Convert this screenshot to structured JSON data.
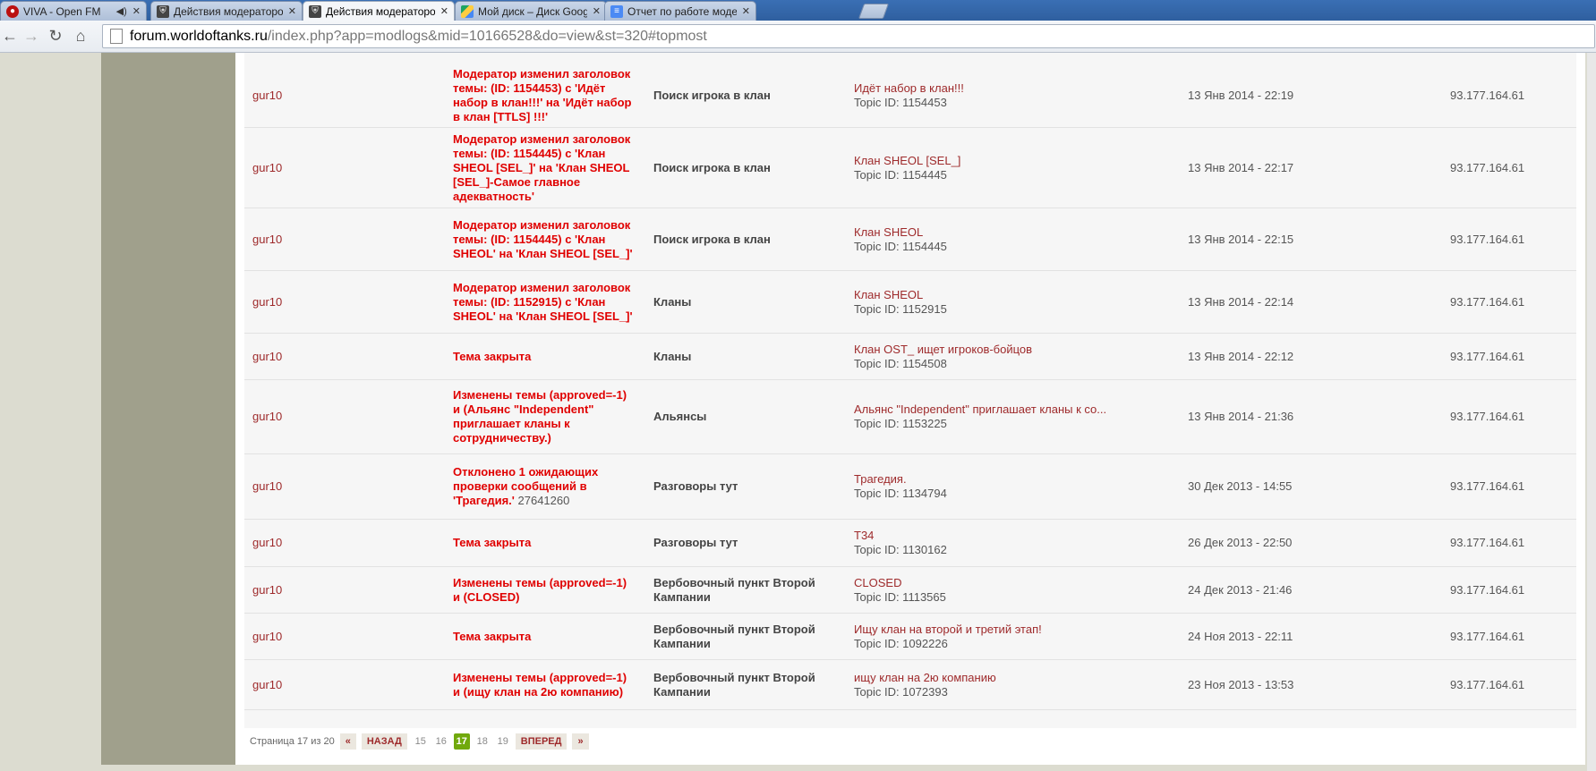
{
  "browser": {
    "tabs": [
      {
        "title": "VIVA - Open FM",
        "icon": "radio-icon",
        "extra": "speaker-icon"
      },
      {
        "title": "Действия модераторов - ",
        "icon": "wot-icon"
      },
      {
        "title": "Действия модераторов - ",
        "icon": "wot-icon",
        "active": true
      },
      {
        "title": "Мой диск – Диск Google",
        "icon": "google-drive-icon"
      },
      {
        "title": "Отчет по работе модерат",
        "icon": "google-docs-icon"
      }
    ],
    "url_host": "forum.worldoftanks.ru",
    "url_path": "/index.php?app=modlogs&mid=10166528&do=view&st=320#topmost"
  },
  "rows": [
    {
      "user": "gur10",
      "action": "Модератор изменил заголовок темы: (ID: 1154453) с 'Идёт набор в клан!!!' на 'Идёт набор в клан [TTLS] !!!'",
      "action_id": "",
      "forum": "Поиск игрока в клан",
      "topic_title": "Идёт набор в клан!!!",
      "topic_id": "Topic ID: 1154453",
      "date": "13 Янв 2014 - 22:19",
      "ip": "93.177.164.61"
    },
    {
      "user": "gur10",
      "action": "Модератор изменил заголовок темы: (ID: 1154445) с 'Клан SHEOL [SEL_]' на 'Клан SHEOL [SEL_]-Самое главное адекватность'",
      "action_id": "",
      "forum": "Поиск игрока в клан",
      "topic_title": "Клан SHEOL [SEL_]",
      "topic_id": "Topic ID: 1154445",
      "date": "13 Янв 2014 - 22:17",
      "ip": "93.177.164.61"
    },
    {
      "user": "gur10",
      "action": "Модератор изменил заголовок темы: (ID: 1154445) с 'Клан SHEOL' на 'Клан SHEOL [SEL_]'",
      "action_id": "",
      "forum": "Поиск игрока в клан",
      "topic_title": "Клан SHEOL",
      "topic_id": "Topic ID: 1154445",
      "date": "13 Янв 2014 - 22:15",
      "ip": "93.177.164.61"
    },
    {
      "user": "gur10",
      "action": "Модератор изменил заголовок темы: (ID: 1152915) с 'Клан SHEOL' на 'Клан SHEOL [SEL_]'",
      "action_id": "",
      "forum": "Кланы",
      "topic_title": "Клан SHEOL",
      "topic_id": "Topic ID: 1152915",
      "date": "13 Янв 2014 - 22:14",
      "ip": "93.177.164.61"
    },
    {
      "user": "gur10",
      "action": "Тема закрыта",
      "action_id": "",
      "forum": "Кланы",
      "topic_title": "Клан OST_ ищет игроков-бойцов",
      "topic_id": "Topic ID: 1154508",
      "date": "13 Янв 2014 - 22:12",
      "ip": "93.177.164.61"
    },
    {
      "user": "gur10",
      "action": "Изменены темы (approved=-1) и (Альянс \"Independent\" приглашает кланы к сотрудничеству.)",
      "action_id": "",
      "forum": "Альянсы",
      "topic_title": "Альянс \"Independent\" приглашает кланы к со...",
      "topic_id": "Topic ID: 1153225",
      "date": "13 Янв 2014 - 21:36",
      "ip": "93.177.164.61"
    },
    {
      "user": "gur10",
      "action": "Отклонено 1 ожидающих проверки сообщений в 'Трагедия.'",
      "action_id": "27641260",
      "forum": "Разговоры тут",
      "topic_title": "Трагедия.",
      "topic_id": "Topic ID: 1134794",
      "date": "30 Дек 2013 - 14:55",
      "ip": "93.177.164.61"
    },
    {
      "user": "gur10",
      "action": "Тема закрыта",
      "action_id": "",
      "forum": "Разговоры тут",
      "topic_title": "T34",
      "topic_id": "Topic ID: 1130162",
      "date": "26 Дек 2013 - 22:50",
      "ip": "93.177.164.61"
    },
    {
      "user": "gur10",
      "action": "Изменены темы (approved=-1) и (CLOSED)",
      "action_id": "",
      "forum": "Вербовочный пункт Второй Кампании",
      "topic_title": "CLOSED",
      "topic_id": "Topic ID: 1113565",
      "date": "24 Дек 2013 - 21:46",
      "ip": "93.177.164.61"
    },
    {
      "user": "gur10",
      "action": "Тема закрыта",
      "action_id": "",
      "forum": "Вербовочный пункт Второй Кампании",
      "topic_title": "Ищу клан на второй и третий этап!",
      "topic_id": "Topic ID: 1092226",
      "date": "24 Ноя 2013 - 22:11",
      "ip": "93.177.164.61"
    },
    {
      "user": "gur10",
      "action": "Изменены темы (approved=-1) и (ищу клан на 2ю компанию)",
      "action_id": "",
      "forum": "Вербовочный пункт Второй Кампании",
      "topic_title": "ищу клан на 2ю компанию",
      "topic_id": "Topic ID: 1072393",
      "date": "23 Ноя 2013 - 13:53",
      "ip": "93.177.164.61"
    }
  ],
  "pagination": {
    "label": "Страница 17 из 20",
    "first": "«",
    "prev": "НАЗАД",
    "pages": [
      "15",
      "16",
      "17",
      "18",
      "19"
    ],
    "current": "17",
    "next": "ВПЕРЕД",
    "last": "»"
  },
  "colors": {
    "accent_red": "#e00000",
    "link_maroon": "#9e2a2b",
    "active_page": "#71a90d"
  }
}
